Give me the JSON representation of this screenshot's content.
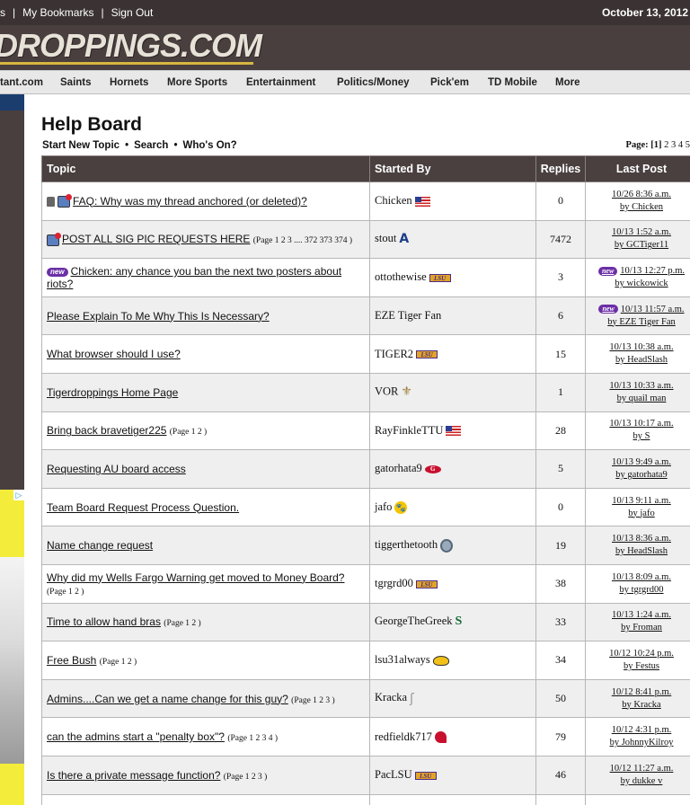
{
  "header": {
    "links": [
      "s",
      "My Bookmarks",
      "Sign Out"
    ],
    "date": "October 13, 2012",
    "logo_text": "DROPPINGS.COM"
  },
  "nav": {
    "items": [
      "tant.com",
      "Saints",
      "Hornets",
      "More Sports",
      "Entertainment",
      "Politics/Money",
      "Pick'em",
      "TD Mobile",
      "More"
    ]
  },
  "board": {
    "title": "Help Board",
    "actions": [
      "Start New Topic",
      "Search",
      "Who's On?"
    ],
    "pager": {
      "label": "Page:",
      "current": "[1]",
      "pages": "2 3 4 5"
    }
  },
  "table": {
    "headers": {
      "topic": "Topic",
      "started_by": "Started By",
      "replies": "Replies",
      "last_post": "Last Post"
    },
    "rows": [
      {
        "topic": "FAQ: Why was my thread anchored (or deleted)?",
        "pages": "",
        "starter": "Chicken",
        "replies": "0",
        "last_time": "10/26 8:36 a.m.",
        "last_by": "by Chicken"
      },
      {
        "topic": "POST ALL SIG PIC REQUESTS HERE",
        "pages": "(Page 1 2 3 .... 372 373 374 )",
        "starter": "stout",
        "replies": "7472",
        "last_time": "10/13 1:52 a.m.",
        "last_by": "by GCTiger11"
      },
      {
        "topic": "Chicken: any chance you ban the next two posters about riots?",
        "pages": "",
        "starter": "ottothewise",
        "replies": "3",
        "last_time": "10/13 12:27 p.m.",
        "last_by": "by wickowick"
      },
      {
        "topic": "Please Explain To Me Why This Is Necessary?",
        "pages": "",
        "starter": "EZE Tiger Fan",
        "replies": "6",
        "last_time": "10/13 11:57 a.m.",
        "last_by": "by EZE Tiger Fan"
      },
      {
        "topic": "What browser should I use?",
        "pages": "",
        "starter": "TIGER2",
        "replies": "15",
        "last_time": "10/13 10:38 a.m.",
        "last_by": "by HeadSlash"
      },
      {
        "topic": "Tigerdroppings Home Page",
        "pages": "",
        "starter": "VOR",
        "replies": "1",
        "last_time": "10/13 10:33 a.m.",
        "last_by": "by quail man"
      },
      {
        "topic": "Bring back bravetiger225",
        "pages": "(Page 1 2 )",
        "starter": "RayFinkleTTU",
        "replies": "28",
        "last_time": "10/13 10:17 a.m.",
        "last_by": "by S"
      },
      {
        "topic": "Requesting AU board access",
        "pages": "",
        "starter": "gatorhata9",
        "replies": "5",
        "last_time": "10/13 9:49 a.m.",
        "last_by": "by gatorhata9"
      },
      {
        "topic": "Team Board Request Process Question.",
        "pages": "",
        "starter": "jafo",
        "replies": "0",
        "last_time": "10/13 9:11 a.m.",
        "last_by": "by jafo"
      },
      {
        "topic": "Name change request",
        "pages": "",
        "starter": "tiggerthetooth",
        "replies": "19",
        "last_time": "10/13 8:36 a.m.",
        "last_by": "by HeadSlash"
      },
      {
        "topic": "Why did my Wells Fargo Warning get moved to Money Board?",
        "pages": "(Page 1 2 )",
        "starter": "tgrgrd00",
        "replies": "38",
        "last_time": "10/13 8:09 a.m.",
        "last_by": "by tgrgrd00"
      },
      {
        "topic": "Time to allow hand bras",
        "pages": "(Page 1 2 )",
        "starter": "GeorgeTheGreek",
        "replies": "33",
        "last_time": "10/13 1:24 a.m.",
        "last_by": "by Froman"
      },
      {
        "topic": "Free Bush",
        "pages": "(Page 1 2 )",
        "starter": "lsu31always",
        "replies": "34",
        "last_time": "10/12 10:24 p.m.",
        "last_by": "by Festus"
      },
      {
        "topic": "Admins....Can we get a name change for this guy?",
        "pages": "(Page 1 2 3 )",
        "starter": "Kracka",
        "replies": "50",
        "last_time": "10/12 8:41 p.m.",
        "last_by": "by Kracka"
      },
      {
        "topic": "can the admins start a \"penalty box\"?",
        "pages": "(Page 1 2 3 4 )",
        "starter": "redfieldk717",
        "replies": "79",
        "last_time": "10/12 4:31 p.m.",
        "last_by": "by JohnnyKilroy"
      },
      {
        "topic": "Is there a private message function?",
        "pages": "(Page 1 2 3 )",
        "starter": "PacLSU",
        "replies": "46",
        "last_time": "10/12 11:27 a.m.",
        "last_by": "by dukke v"
      }
    ]
  },
  "badges": {
    "new": "new",
    "lsu": "LSU"
  }
}
